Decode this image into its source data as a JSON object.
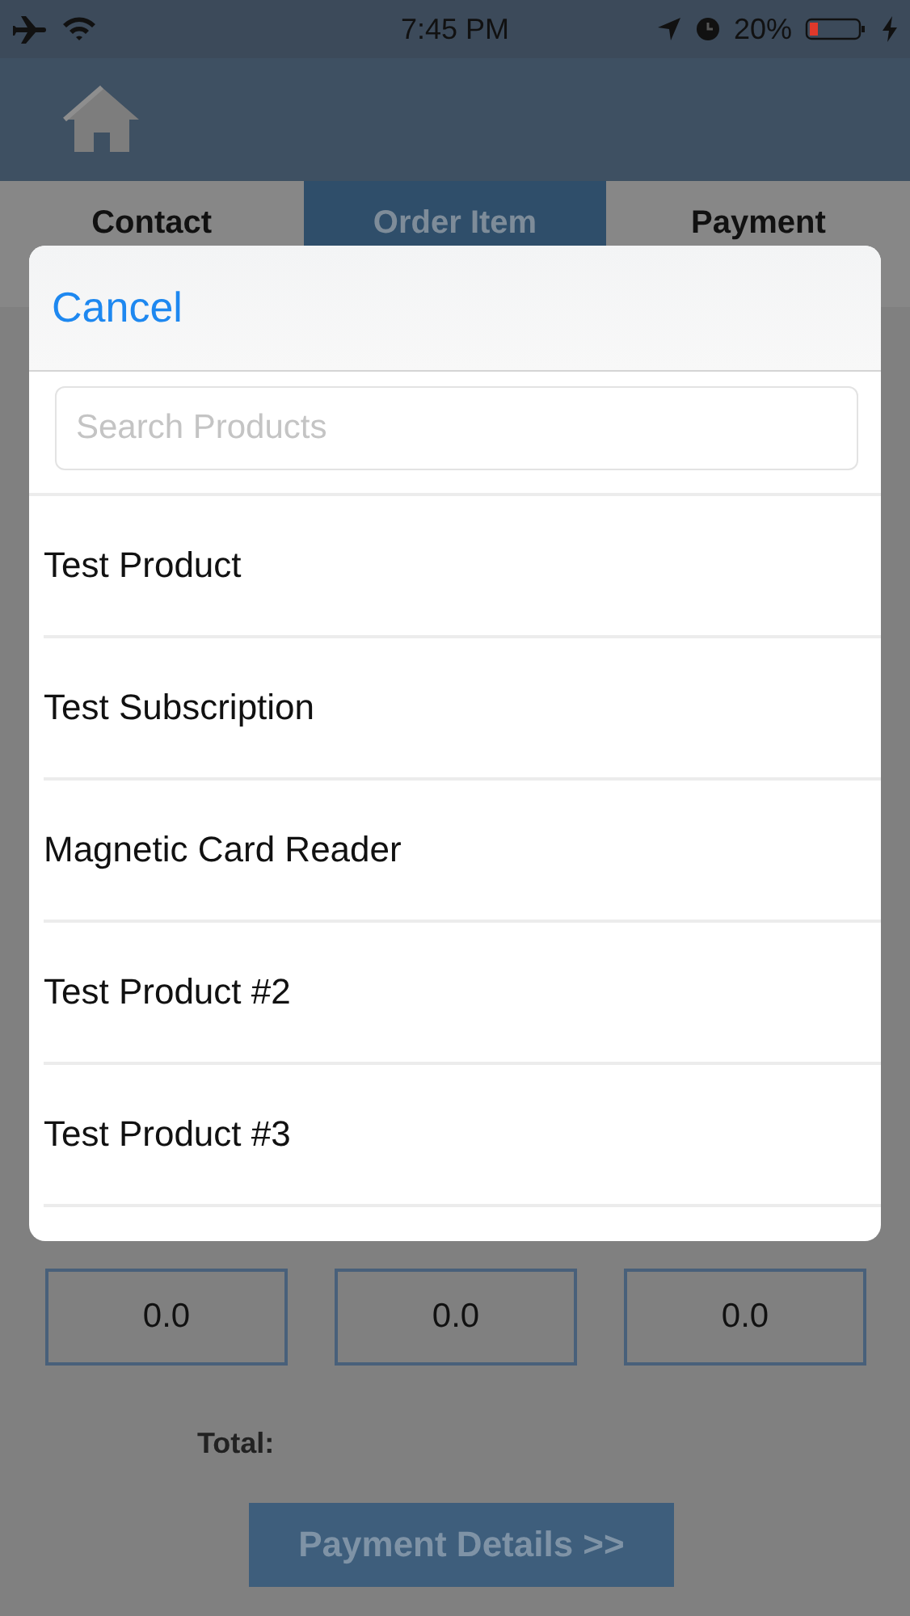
{
  "status_bar": {
    "time": "7:45 PM",
    "battery_text": "20%"
  },
  "tabs": [
    {
      "label": "Contact",
      "selected": false
    },
    {
      "label": "Order Item",
      "selected": true
    },
    {
      "label": "Payment",
      "selected": false
    }
  ],
  "picker": {
    "cancel": "Cancel",
    "search": {
      "placeholder": "Search Products"
    },
    "items": [
      "Test Product",
      "Test Subscription",
      "Magnetic Card Reader",
      "Test Product #2",
      "Test Product #3"
    ]
  },
  "amounts": [
    "0.0",
    "0.0",
    "0.0"
  ],
  "total_label": "Total:",
  "payment_button": "Payment Details >>"
}
